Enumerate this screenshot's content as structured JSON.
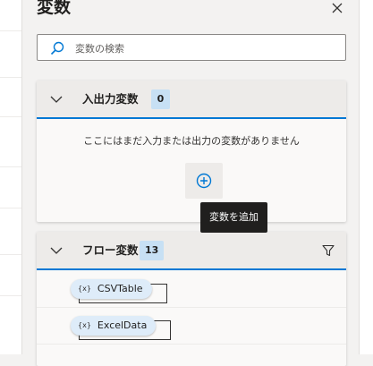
{
  "pane": {
    "title": "変数",
    "search_placeholder": "変数の検索"
  },
  "input_output": {
    "title": "入出力変数",
    "count": "0",
    "empty_message": "ここにはまだ入力または出力の変数がありません",
    "add_tooltip": "変数を追加"
  },
  "flow_vars": {
    "title": "フロー変数",
    "count": "13",
    "items": [
      {
        "icon": "{x}",
        "name": "CSVTable"
      },
      {
        "icon": "{x}",
        "name": "ExcelData"
      }
    ]
  },
  "colors": {
    "accent": "#0078d4",
    "badge": "#c7e0f4",
    "chip": "#deecf9",
    "tooltip_bg": "#201f1e"
  },
  "icons": {
    "close": "close-icon",
    "search": "search-icon",
    "collapse": "chevron-down-icon",
    "add": "add-circle-icon",
    "filter": "filter-icon",
    "variable": "variable-icon"
  }
}
